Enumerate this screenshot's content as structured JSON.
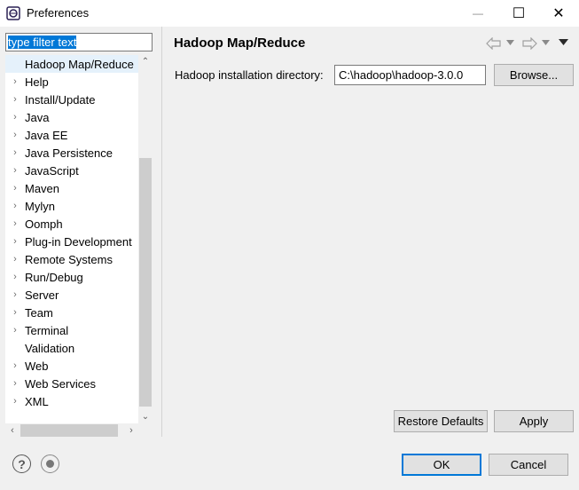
{
  "window": {
    "title": "Preferences",
    "minimize_glyph": "—",
    "maximize_glyph": "☐",
    "close_glyph": "✕"
  },
  "sidebar": {
    "filter_text": "type filter text",
    "items": [
      {
        "label": "Hadoop Map/Reduce",
        "expandable": false,
        "selected": true
      },
      {
        "label": "Help",
        "expandable": true
      },
      {
        "label": "Install/Update",
        "expandable": true
      },
      {
        "label": "Java",
        "expandable": true
      },
      {
        "label": "Java EE",
        "expandable": true
      },
      {
        "label": "Java Persistence",
        "expandable": true
      },
      {
        "label": "JavaScript",
        "expandable": true
      },
      {
        "label": "Maven",
        "expandable": true
      },
      {
        "label": "Mylyn",
        "expandable": true
      },
      {
        "label": "Oomph",
        "expandable": true
      },
      {
        "label": "Plug-in Development",
        "expandable": true
      },
      {
        "label": "Remote Systems",
        "expandable": true
      },
      {
        "label": "Run/Debug",
        "expandable": true
      },
      {
        "label": "Server",
        "expandable": true
      },
      {
        "label": "Team",
        "expandable": true
      },
      {
        "label": "Terminal",
        "expandable": true
      },
      {
        "label": "Validation",
        "expandable": false
      },
      {
        "label": "Web",
        "expandable": true
      },
      {
        "label": "Web Services",
        "expandable": true
      },
      {
        "label": "XML",
        "expandable": true
      }
    ]
  },
  "page": {
    "title": "Hadoop Map/Reduce",
    "field_label": "Hadoop installation directory:",
    "field_value": "C:\\hadoop\\hadoop-3.0.0",
    "browse_label": "Browse...",
    "restore_label": "Restore Defaults",
    "apply_label": "Apply"
  },
  "footer": {
    "ok_label": "OK",
    "cancel_label": "Cancel"
  },
  "icons": {
    "back": "back-arrow-icon",
    "forward": "forward-arrow-icon",
    "menu": "view-menu-icon",
    "help": "help-icon",
    "record": "record-macro-icon"
  }
}
